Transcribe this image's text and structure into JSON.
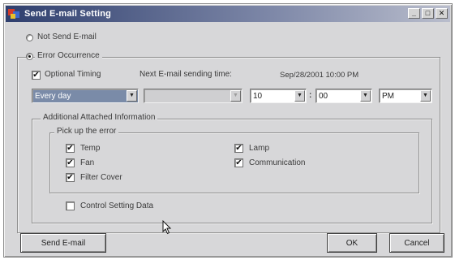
{
  "window": {
    "title": "Send E-mail Setting",
    "controls": {
      "minimize": "_",
      "maximize": "□",
      "close": "✕"
    }
  },
  "mode": {
    "not_send_label": "Not Send E-mail",
    "not_send_selected": false,
    "error_occurrence_label": "Error Occurrence",
    "error_occurrence_selected": true
  },
  "timing": {
    "optional_timing_label": "Optional Timing",
    "optional_timing_checked": true,
    "next_email_label": "Next E-mail sending time:",
    "next_email_value": "Sep/28/2001 10:00 PM",
    "frequency": "Every day",
    "secondary": "",
    "hour": "10",
    "colon": ":",
    "minute": "00",
    "ampm": "PM"
  },
  "additional": {
    "group_label": "Additional Attached Information",
    "pickup_label": "Pick up the error",
    "errors": [
      {
        "label": "Temp",
        "checked": true
      },
      {
        "label": "Fan",
        "checked": true
      },
      {
        "label": "Filter Cover",
        "checked": true
      },
      {
        "label": "Lamp",
        "checked": true
      },
      {
        "label": "Communication",
        "checked": true
      }
    ],
    "control_setting_label": "Control Setting Data",
    "control_setting_checked": false
  },
  "buttons": {
    "send": "Send E-mail",
    "ok": "OK",
    "cancel": "Cancel"
  },
  "icons": {
    "check": "✔",
    "dropdown": "▼"
  }
}
